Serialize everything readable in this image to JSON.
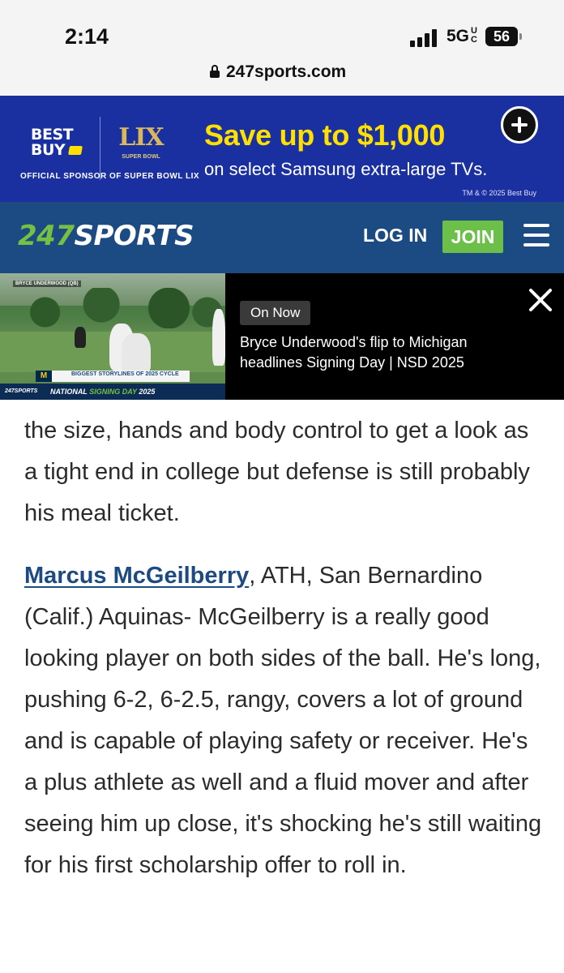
{
  "status_bar": {
    "time": "2:14",
    "network": "5G",
    "network_suffix": "UC",
    "battery": "56"
  },
  "browser": {
    "url": "247sports.com"
  },
  "ad": {
    "brand": "BEST BUY",
    "event_number": "LIX",
    "event_caption": "SUPER BOWL",
    "sponsor_line": "OFFICIAL SPONSOR OF SUPER BOWL LIX",
    "headline": "Save up to $1,000",
    "subline": "on select Samsung extra-large TVs.",
    "legal": "TM & © 2025 Best Buy",
    "colors": {
      "background": "#1a2fa0",
      "headline": "#ffe000"
    }
  },
  "header": {
    "logo_number": "247",
    "logo_word": "SPORTS",
    "login_label": "LOG IN",
    "join_label": "JOIN",
    "colors": {
      "background": "#1c4a83",
      "join": "#6cc04a"
    }
  },
  "video": {
    "thumb_top_label": "BRYCE UNDERWOOD (QB)",
    "thumb_lower_label": "BIGGEST STORYLINES OF 2025 CYCLE",
    "thumb_strip_logo": "247SPORTS",
    "thumb_strip_prefix": "NATIONAL",
    "thumb_strip_highlight": "SIGNING DAY",
    "thumb_strip_year": "2025",
    "badge": "On Now",
    "title": "Bryce Underwood's flip to Michigan headlines Signing Day | NSD 2025"
  },
  "article": {
    "paragraph_1": "the size, hands and body control to get a look as a tight end in college but defense is still probably his meal ticket.",
    "player_link": "Marcus McGeilberry",
    "paragraph_2": ", ATH, San Bernardino (Calif.) Aquinas- McGeilberry is a really good looking player on both sides of the ball. He's long, pushing 6-2, 6-2.5, rangy, covers a lot of ground and is capable of playing safety or receiver. He's a plus athlete as well and a fluid mover and after seeing him up close, it's shocking he's still waiting for his first scholarship offer to roll in."
  }
}
